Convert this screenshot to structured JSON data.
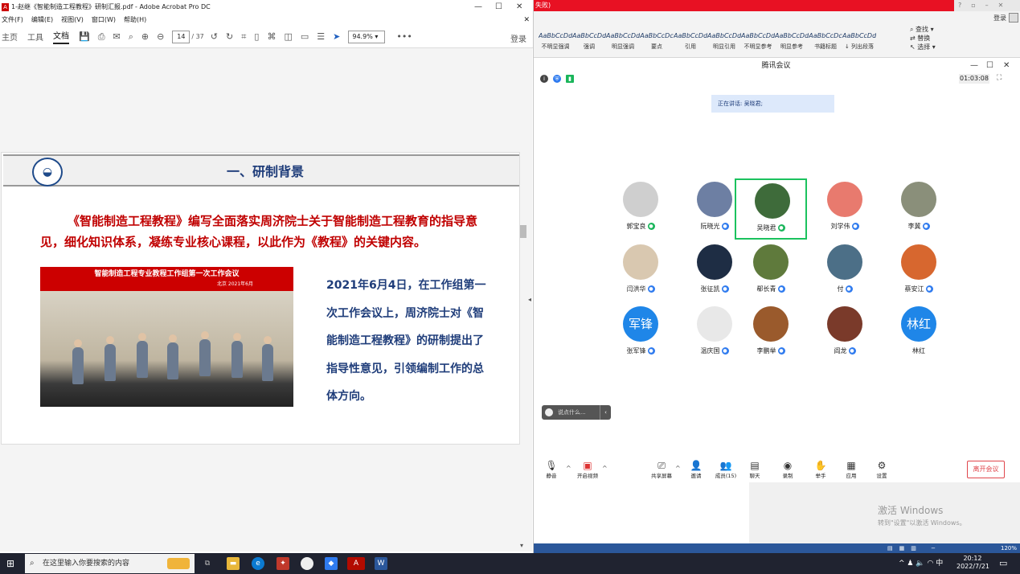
{
  "acrobat": {
    "title": "1-赵继《智能制造工程教程》研制汇报.pdf - Adobe Acrobat Pro DC",
    "menu": [
      "文件(F)",
      "编辑(E)",
      "视图(V)",
      "窗口(W)",
      "帮助(H)"
    ],
    "tabs": {
      "home": "主页",
      "tools": "工具",
      "document": "文档"
    },
    "page_current": "14",
    "page_total": "/ 37",
    "zoom": "94.9%",
    "login": "登录"
  },
  "slide": {
    "header_title": "一、研制背景",
    "logo_glyph": "◒",
    "paragraph": "《智能制造工程教程》编写全面落实周济院士关于智能制造工程教育的指导意见，细化知识体系，凝练专业核心课程，以此作为《教程》的关键内容。",
    "photo_banner": "智能制造工程专业教程工作组第一次工作会议",
    "photo_date": "北京 2021年6月",
    "side_text": "2021年6月4日，在工作组第一次工作会议上，周济院士对《智能制造工程教程》的研制提出了指导性意见，引领编制工作的总体方向。"
  },
  "word": {
    "red_bar_text": "失败)",
    "login": "登录",
    "styles": [
      {
        "sample": "AaBbCcDd",
        "name": "不明显强调"
      },
      {
        "sample": "AaBbCcDd",
        "name": "强调"
      },
      {
        "sample": "AaBbCcDd",
        "name": "明显强调"
      },
      {
        "sample": "AaBbCcDc",
        "name": "要点"
      },
      {
        "sample": "AaBbCcDd",
        "name": "引用"
      },
      {
        "sample": "AaBbCcDd",
        "name": "明显引用"
      },
      {
        "sample": "AaBbCcDd",
        "name": "不明显参考"
      },
      {
        "sample": "AaBbCcDd",
        "name": "明显参考"
      },
      {
        "sample": "AaBbCcDc",
        "name": "书籍标题"
      },
      {
        "sample": "AaBbCcDd",
        "name": "↓ 列出段落"
      }
    ],
    "edit": {
      "find": "查找",
      "replace": "替换",
      "select": "选择"
    },
    "watermark_title": "激活 Windows",
    "watermark_sub": "转到\"设置\"以激活 Windows。",
    "zoom": "120%"
  },
  "meeting": {
    "title": "腾讯会议",
    "timer": "01:03:08",
    "speaking": "正在讲话: 吴晓君;",
    "participants": [
      {
        "name": "郭宝良",
        "color": "#cfcfcf",
        "initials": "",
        "mic": "green"
      },
      {
        "name": "阮晓光",
        "color": "#6d7fa3",
        "initials": "",
        "mic": "blue"
      },
      {
        "name": "吴晓君",
        "color": "#3e6b3a",
        "initials": "",
        "mic": "green"
      },
      {
        "name": "刘学伟",
        "color": "#e87a6e",
        "initials": "",
        "mic": "blue"
      },
      {
        "name": "李冀",
        "color": "#8a8f7a",
        "initials": "",
        "mic": "blue"
      },
      {
        "name": "闫洪华",
        "color": "#d9c8b0",
        "initials": "",
        "mic": "blue"
      },
      {
        "name": "张征凯",
        "color": "#1e2d44",
        "initials": "",
        "mic": "blue"
      },
      {
        "name": "郗长青",
        "color": "#5f7a3c",
        "initials": "",
        "mic": "blue"
      },
      {
        "name": "付",
        "color": "#4c6f87",
        "initials": "",
        "mic": "blue"
      },
      {
        "name": "蔡安江",
        "color": "#d7672f",
        "initials": "",
        "mic": "blue"
      },
      {
        "name": "张军锋",
        "color": "#1f86e8",
        "initials": "军锋",
        "mic": "blue"
      },
      {
        "name": "温庆国",
        "color": "#e8e8e8",
        "initials": "",
        "mic": "blue"
      },
      {
        "name": "李鹏举",
        "color": "#9a5a2c",
        "initials": "",
        "mic": "blue"
      },
      {
        "name": "阎龙",
        "color": "#7a3a2a",
        "initials": "",
        "mic": "blue"
      },
      {
        "name": "林红",
        "color": "#1f86e8",
        "initials": "林红",
        "mic": "none"
      }
    ],
    "chat_placeholder": "说点什么...",
    "toolbar": {
      "mute": "静音",
      "video": "开启视频",
      "share": "共享屏幕",
      "invite": "邀请",
      "members": "成员(15)",
      "chat": "聊天",
      "record": "录制",
      "raise": "举手",
      "apps": "应用",
      "settings": "设置",
      "leave": "离开会议"
    }
  },
  "taskbar": {
    "search_placeholder": "在这里输入你要搜索的内容",
    "time": "20:12",
    "date": "2022/7/21",
    "ime": "中"
  }
}
